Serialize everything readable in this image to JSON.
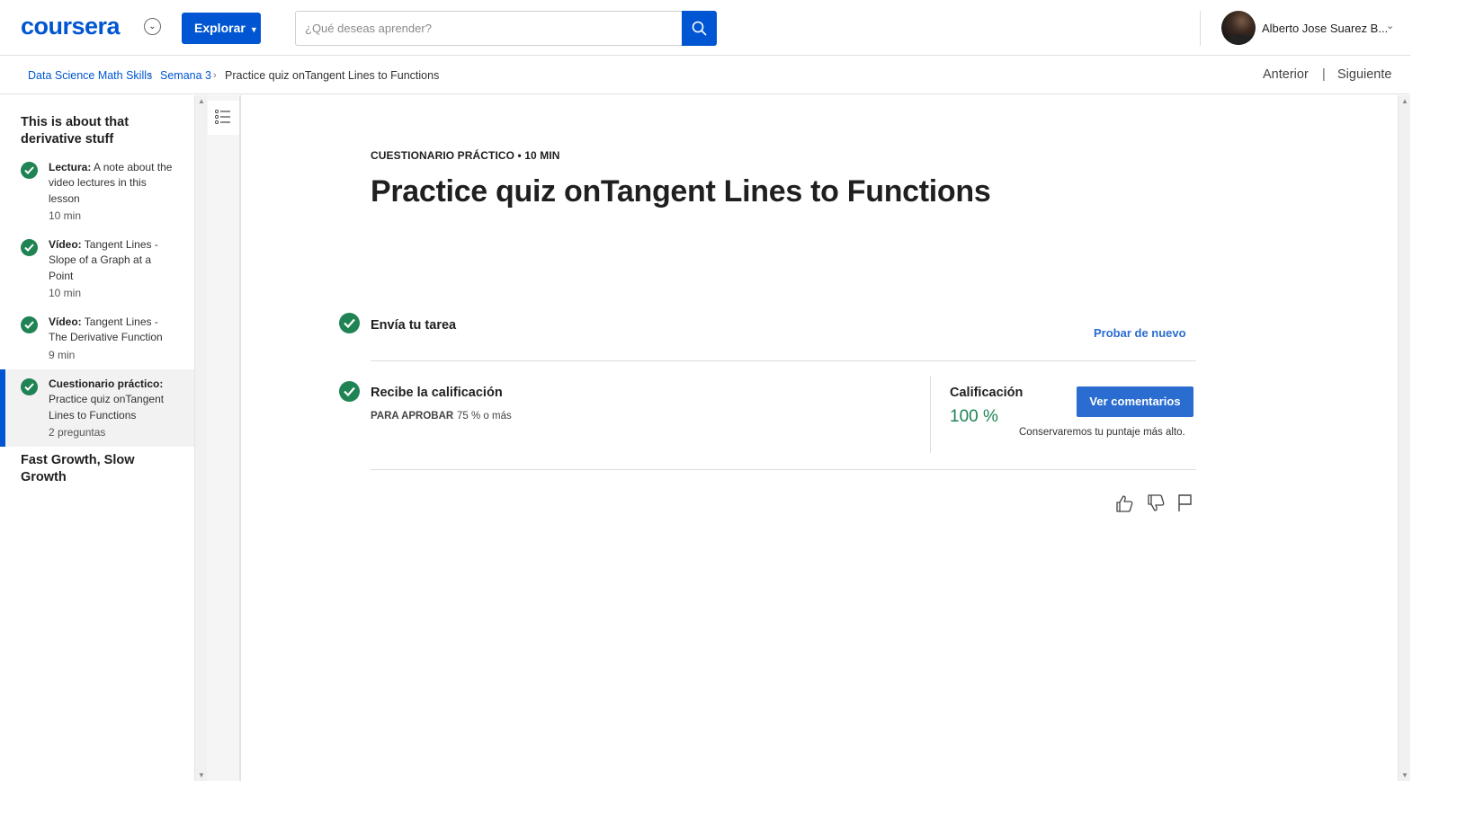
{
  "header": {
    "logo": "coursera",
    "explore_label": "Explorar",
    "search_placeholder": "¿Qué deseas aprender?",
    "user_name": "Alberto Jose Suarez B...",
    "brand_color": "#0056d2"
  },
  "breadcrumb": {
    "items": [
      "Data Science Math Skills",
      "Semana 3",
      "Practice quiz onTangent Lines to Functions"
    ],
    "prev_label": "Anterior",
    "separator": "|",
    "next_label": "Siguiente"
  },
  "sidebar": {
    "lesson_title": "This is about that derivative stuff",
    "items": [
      {
        "type": "Lectura:",
        "title": "A note about the video lectures in this lesson",
        "meta": "10 min",
        "completed": true,
        "active": false
      },
      {
        "type": "Vídeo:",
        "title": "Tangent Lines - Slope of a Graph at a Point",
        "meta": "10 min",
        "completed": true,
        "active": false
      },
      {
        "type": "Vídeo:",
        "title": "Tangent Lines - The Derivative Function",
        "meta": "9 min",
        "completed": true,
        "active": false
      },
      {
        "type": "Cuestionario práctico:",
        "title": "Practice quiz onTangent Lines to Functions",
        "meta": "2 preguntas",
        "completed": true,
        "active": true
      }
    ],
    "next_lesson_title": "Fast Growth, Slow Growth"
  },
  "main": {
    "kicker": "CUESTIONARIO PRÁCTICO • 10 MIN",
    "title": "Practice quiz onTangent Lines to Functions",
    "step1_title": "Envía tu tarea",
    "retry_label": "Probar de nuevo",
    "step2_title": "Recibe la calificación",
    "pass_label": "PARA APROBAR",
    "pass_value": "75 % o más",
    "grade_label": "Calificación",
    "grade_value": "100 %",
    "feedback_label": "Ver comentarios",
    "keep_note": "Conservaremos tu puntaje más alto.",
    "success_color": "#1f8354"
  }
}
